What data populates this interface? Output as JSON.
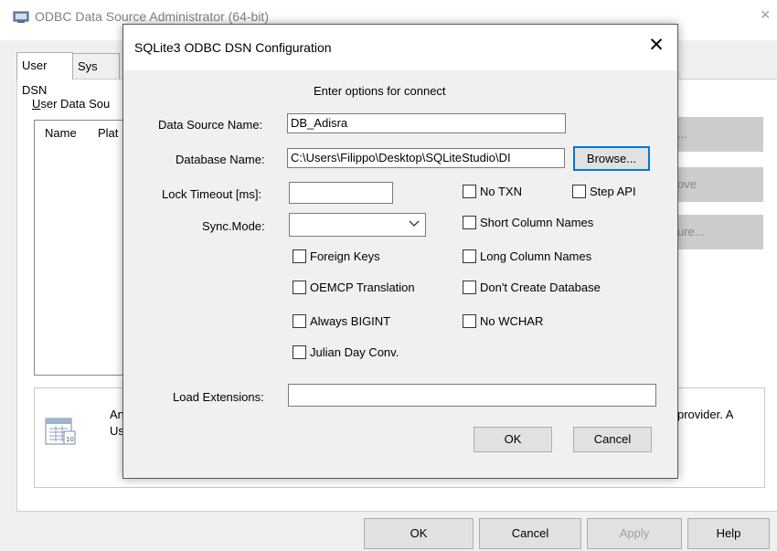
{
  "background_window": {
    "title": "ODBC Data Source Administrator (64-bit)",
    "close_glyph": "×",
    "tabs": [
      "User DSN",
      "Sys"
    ],
    "user_data_sources_label": "User Data Sou",
    "columns": [
      "Name",
      "Plat"
    ],
    "side_buttons": [
      "...",
      "ove",
      "ure..."
    ],
    "info_text_lines": [
      "An",
      "Us"
    ],
    "info_text_right": "provider.  A",
    "bottom_buttons": {
      "ok": "OK",
      "cancel": "Cancel",
      "apply": "Apply",
      "help": "Help"
    }
  },
  "dialog": {
    "title": "SQLite3 ODBC DSN Configuration",
    "close_glyph": "✕",
    "heading": "Enter options for connect",
    "data_source_name": {
      "label": "Data Source Name:",
      "value": "DB_Adisra"
    },
    "database_name": {
      "label": "Database Name:",
      "value": "C:\\Users\\Filippo\\Desktop\\SQLiteStudio\\DI"
    },
    "browse_label": "Browse...",
    "lock_timeout": {
      "label": "Lock Timeout [ms]:",
      "value": ""
    },
    "sync_mode": {
      "label": "Sync.Mode:",
      "value": ""
    },
    "checkboxes_left": [
      {
        "label": "Foreign Keys",
        "checked": false
      },
      {
        "label": "OEMCP Translation",
        "checked": false
      },
      {
        "label": "Always BIGINT",
        "checked": false
      },
      {
        "label": "Julian Day Conv.",
        "checked": false
      }
    ],
    "checkboxes_right": [
      {
        "label": "No TXN",
        "checked": false
      },
      {
        "label": "Short Column Names",
        "checked": false
      },
      {
        "label": "Long Column Names",
        "checked": false
      },
      {
        "label": "Don't Create Database",
        "checked": false
      },
      {
        "label": "No WCHAR",
        "checked": false
      }
    ],
    "step_api": {
      "label": "Step API",
      "checked": false
    },
    "load_extensions": {
      "label": "Load Extensions:",
      "value": ""
    },
    "ok_label": "OK",
    "cancel_label": "Cancel"
  },
  "icons": {
    "app_icon": "odbc-admin-icon",
    "info_icon": "database-info-icon",
    "dropdown": "chevron-down-icon"
  }
}
